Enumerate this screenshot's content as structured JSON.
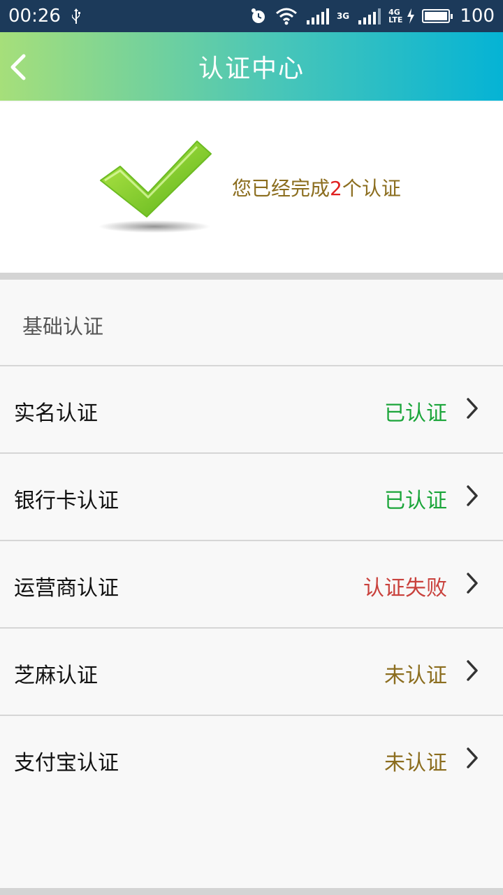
{
  "status_bar": {
    "time": "00:26",
    "network_3g": "3G",
    "network_4g": "4G",
    "network_lte": "LTE",
    "battery_level": "100"
  },
  "nav": {
    "title": "认证中心",
    "back_icon": "chevron-left-icon"
  },
  "summary": {
    "prefix": "您已经完成",
    "count": "2",
    "suffix": "个认证",
    "icon": "checkmark-icon"
  },
  "section": {
    "title": "基础认证"
  },
  "items": [
    {
      "label": "实名认证",
      "status": "已认证",
      "status_color": "#1ba53a"
    },
    {
      "label": "银行卡认证",
      "status": "已认证",
      "status_color": "#1ba53a"
    },
    {
      "label": "运营商认证",
      "status": "认证失败",
      "status_color": "#c9413c"
    },
    {
      "label": "芝麻认证",
      "status": "未认证",
      "status_color": "#8b6d1e"
    },
    {
      "label": "支付宝认证",
      "status": "未认证",
      "status_color": "#8b6d1e"
    }
  ],
  "colors": {
    "status_bar_bg": "#1c3a5a",
    "nav_gradient_start": "#a6df7a",
    "nav_gradient_end": "#05b3d5",
    "summary_text": "#8b6d1e",
    "summary_count": "#e02020"
  }
}
